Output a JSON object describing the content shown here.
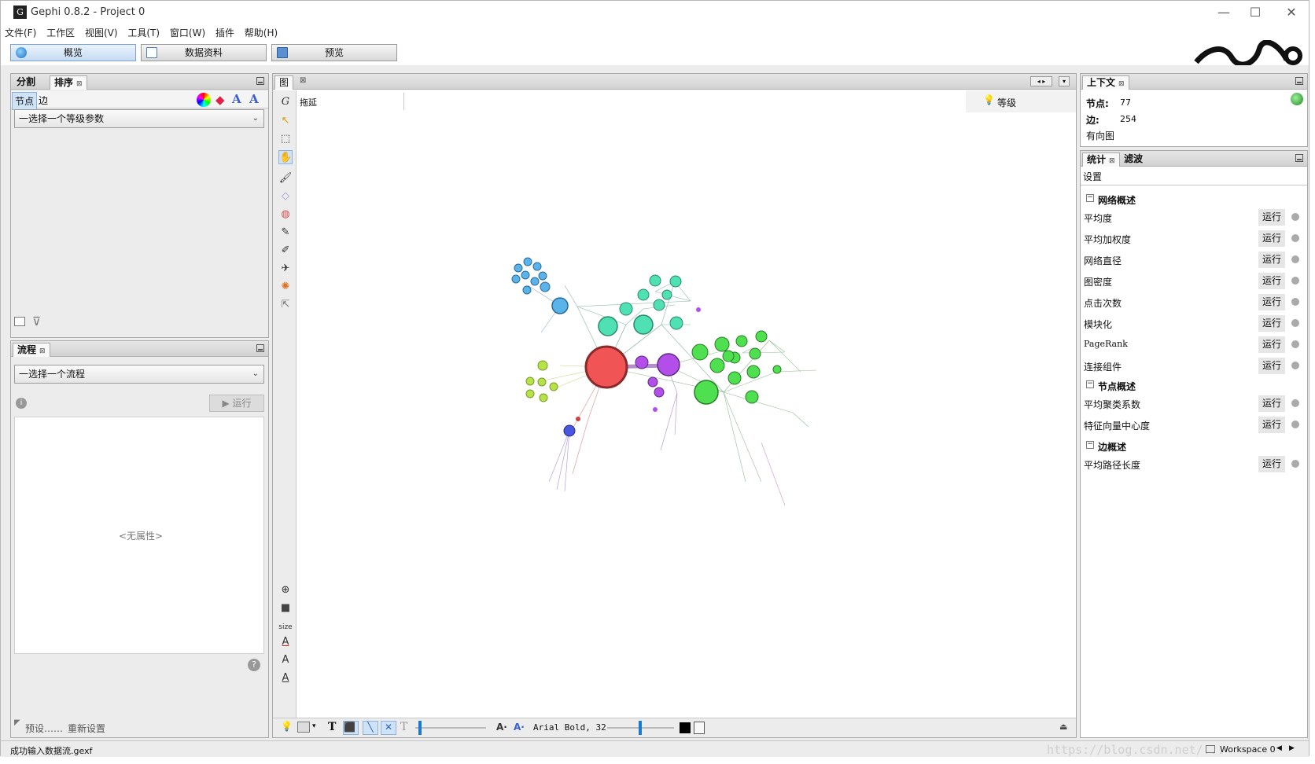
{
  "window": {
    "title": "Gephi 0.8.2 - Project 0",
    "minimize": "—",
    "maximize": "☐",
    "close": "✕"
  },
  "menu": [
    "文件(F)",
    "工作区",
    "视图(V)",
    "工具(T)",
    "窗口(W)",
    "插件",
    "帮助(H)"
  ],
  "main_tabs": [
    {
      "label": "概览",
      "active": true
    },
    {
      "label": "数据资料",
      "active": false
    },
    {
      "label": "预览",
      "active": false
    }
  ],
  "ranking_panel": {
    "tabs": [
      "分割",
      "排序"
    ],
    "subtabs": [
      "节点",
      "边"
    ],
    "combo": "一选择一个等级参数"
  },
  "flow_panel": {
    "tab": "流程",
    "combo": "一选择一个流程",
    "run": "运行",
    "no_properties": "<无属性>",
    "presets": "预设……",
    "reset": "重新设置"
  },
  "graph_panel": {
    "tab": "图",
    "drag_label": "拖延",
    "rank_label": "等级",
    "size_label": "size",
    "font_label": "Arial Bold, 32"
  },
  "context_panel": {
    "tab": "上下文",
    "nodes_label": "节点:",
    "nodes_value": "77",
    "edges_label": "边:",
    "edges_value": "254",
    "graph_type": "有向图"
  },
  "stats_panel": {
    "tabs": [
      "统计",
      "滤波"
    ],
    "settings": "设置",
    "sections": [
      {
        "title": "网络概述",
        "items": [
          "平均度",
          "平均加权度",
          "网络直径",
          "图密度",
          "点击次数",
          "模块化",
          "PageRank",
          "连接组件"
        ]
      },
      {
        "title": "节点概述",
        "items": [
          "平均聚类系数",
          "特征向量中心度"
        ]
      },
      {
        "title": "边概述",
        "items": [
          "平均路径长度"
        ]
      }
    ],
    "run_label": "运行"
  },
  "status": {
    "message": "成功输入数据流.gexf",
    "workspace": "Workspace 0",
    "watermark": "https://blog.csdn.net/..."
  },
  "colors": {
    "accent_red": "#f05454",
    "blue": "#5ab4ea",
    "teal": "#4fe0b4",
    "green": "#4ee04e",
    "lime": "#b6e24a",
    "purple": "#b34fe8",
    "dark_blue": "#4a55e0"
  }
}
